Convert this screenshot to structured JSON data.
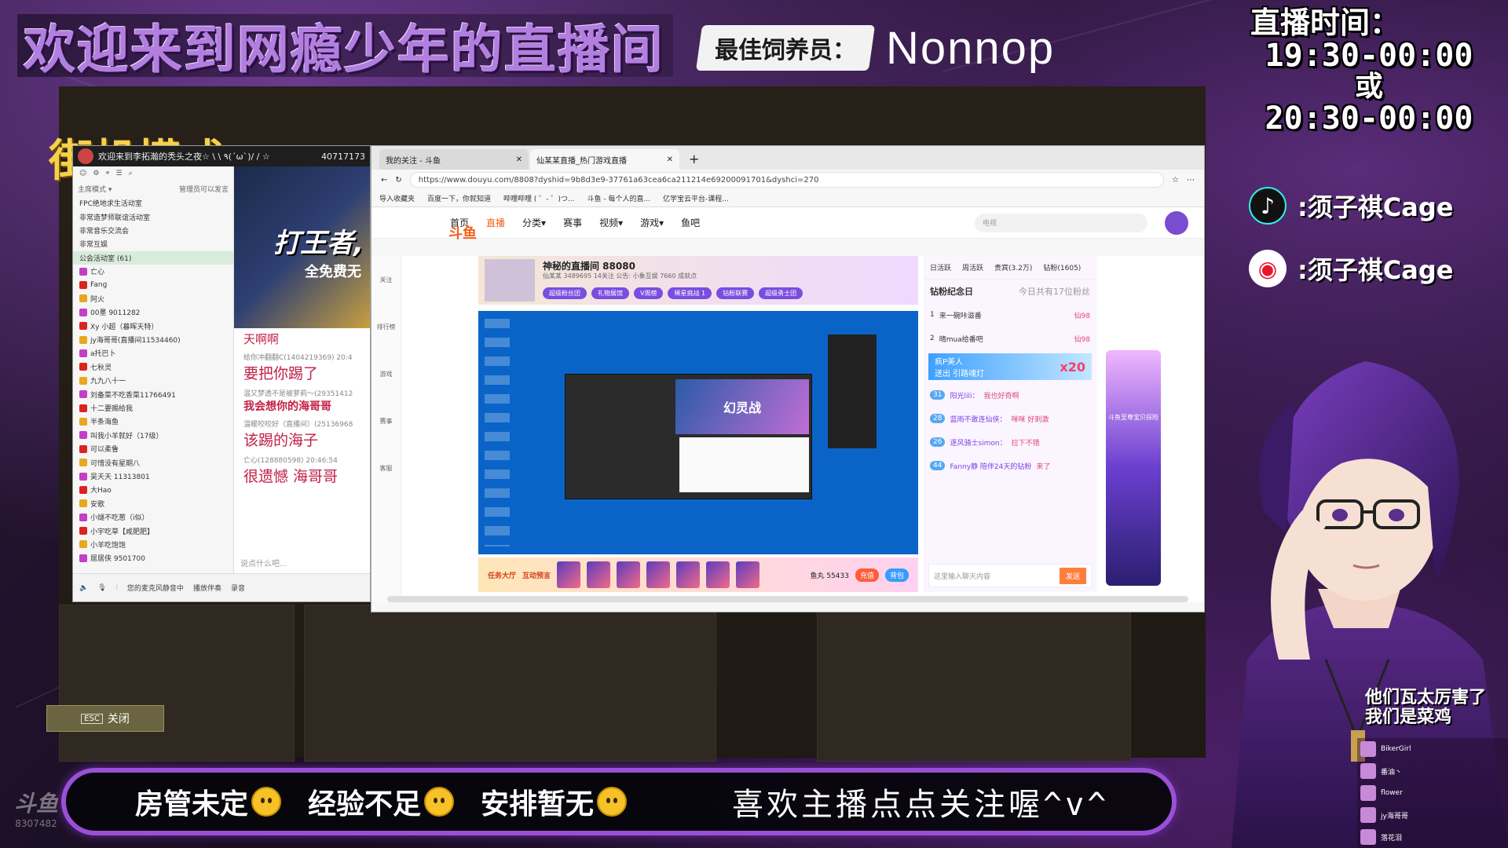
{
  "header": {
    "welcome": "欢迎来到网瘾少年的直播间",
    "best_feeder_label": "最佳饲养员：",
    "best_feeder_name": "Nonnop"
  },
  "schedule": {
    "title": "直播时间：",
    "time1": "19:30-00:00",
    "or": "或",
    "time2": "20:30-00:00"
  },
  "socials": {
    "tiktok": ":须子祺Cage",
    "weibo": ":须子祺Cage"
  },
  "mode_title": "街机模式",
  "esc": {
    "key": "ESC",
    "label": "关闭"
  },
  "client": {
    "title": "欢迎来到李拓瀚的秃头之夜☆ \\ \\ ٩(ˊωˋ)/ / ☆",
    "room_id": "40717173",
    "tab_left": "主席模式 ▾",
    "tab_right": "管理员可以发言",
    "rows": [
      "FPC绝地求生活动室",
      "非常造梦师联谊活动室",
      "非常音乐交流会",
      "非常互娱",
      "公会活动室 (61)",
      "亡心",
      "Fang",
      "阿火",
      "00墨 9011282",
      "Xy 小超（暮晖天特）",
      "jy海哥哥(直播间11534460)",
      "a托巴卜",
      "七秋灵",
      "九九八十一",
      "刘备菜不吃香菜11766491",
      "十二要赐给我",
      "半条海鱼",
      "叫我小羊就好（17级）",
      "可以柔鲁",
      "可惜没有星期八",
      "吴天天 11313801",
      "大Hao",
      "安歌",
      "小燧不吃葱（i似）",
      "小宇吃草【咸肥肥】",
      "小羊吃饱饱",
      "居居侠 9501700"
    ],
    "promo_line1": "打王者,",
    "promo_line2": "全免费无",
    "chat_top": "天啊啊",
    "messages": [
      {
        "who": "给你冲翻翻C(1404219369) 20:4",
        "says": "要把你踢了",
        "bold": false
      },
      {
        "who": "温又梦透不是被萝莉～(29351412",
        "says": "我会想你的海哥哥",
        "bold": true
      },
      {
        "who": "温暖咬咬好（直播间）(25136968",
        "says": "该踢的海子",
        "bold": false
      },
      {
        "who": "亡心(128880598) 20:46:54",
        "says": "很遗憾 海哥哥",
        "bold": false
      }
    ],
    "input_placeholder": "说点什么吧...",
    "footer_mic": "您的麦克风静音中",
    "footer_music": "播放伴奏",
    "footer_record": "录音"
  },
  "browser": {
    "tab1": "我的关注 - 斗鱼",
    "tab2": "仙某某直播_热门游戏直播",
    "url": "https://www.douyu.com/8808?dyshid=9b8d3e9-37761a63cea6ca211214e69200091701&dyshci=270",
    "favorites": [
      "导入收藏夹",
      "百度一下，你就知道",
      "哔哩哔哩 ( ゜- ゜)つ...",
      "斗鱼 - 每个人的直...",
      "亿学宝云平台-课程..."
    ],
    "nav": [
      "首页",
      "直播",
      "分类▾",
      "赛事",
      "视频▾",
      "游戏▾",
      "鱼吧"
    ],
    "nav_active": "直播",
    "logo": "斗鱼",
    "search_placeholder": "电视",
    "side": [
      "关注",
      "排行榜",
      "游戏",
      "赛事",
      "客服"
    ],
    "room_name": "神秘的直播间 88080",
    "room_meta": "仙某某 3489695 14关注 公告: 小象互娱 7660 成就点",
    "room_buttons": [
      "超级粉丝团",
      "礼物展馆",
      "V周榜",
      "稀星挑战 1",
      "钻粉联赛",
      "超级勇士团"
    ],
    "player_banner": "幻灵战",
    "gift_labels": [
      "任务大厅",
      "互动预言"
    ],
    "fish_balls": "鱼丸 55433",
    "charge": "充值",
    "backpack": "背包",
    "rank_tabs": [
      "日活跃",
      "周活跃",
      "贵宾(3.2万)",
      "钻粉(1605)"
    ],
    "rank_title": "钻粉纪念日",
    "rank_today": "今日共有17位粉丝",
    "rank_items": [
      {
        "tag": "1",
        "name": "来一碗咔滋番",
        "extra": "仙98"
      },
      {
        "tag": "2",
        "name": "晴mua给番吧",
        "extra": "仙98"
      }
    ],
    "chat_lines": [
      {
        "tag": "31",
        "name": "阳光lili：",
        "text": "我也好奇啊"
      },
      {
        "tag": "28",
        "name": "蓝雨不敢连仙侠：",
        "text": "咪咪 好刺激"
      },
      {
        "tag": "26",
        "name": "逐风骑士simon：",
        "text": "拉下不错"
      },
      {
        "tag": "44",
        "name": "Fanny静 陪伴24天的钻粉",
        "text": "来了"
      }
    ],
    "vip_line1": "疯P美人",
    "vip_line2": "送出 引路魂灯",
    "vip_count": "x20",
    "input_placeholder": "这里输入聊天内容",
    "send": "发送",
    "promo_side": "斗鱼至尊宝贝探险"
  },
  "notice": {
    "item1": "房管未定",
    "item2": "经验不足",
    "item3": "安排暂无",
    "follow": "喜欢主播点点关注喔^v^"
  },
  "watermark": {
    "brand": "斗鱼",
    "room": "8307482"
  },
  "caption": {
    "line1": "他们瓦太厉害了",
    "line2": "我们是菜鸡"
  },
  "mini_chat": [
    "BikerGirl",
    "番油丶",
    "flower",
    "jy海哥哥",
    "落花泪"
  ],
  "colors": {
    "accent": "#9b4fd6",
    "douyu_orange": "#f3601a",
    "mode_gold": "#f5d24a"
  }
}
